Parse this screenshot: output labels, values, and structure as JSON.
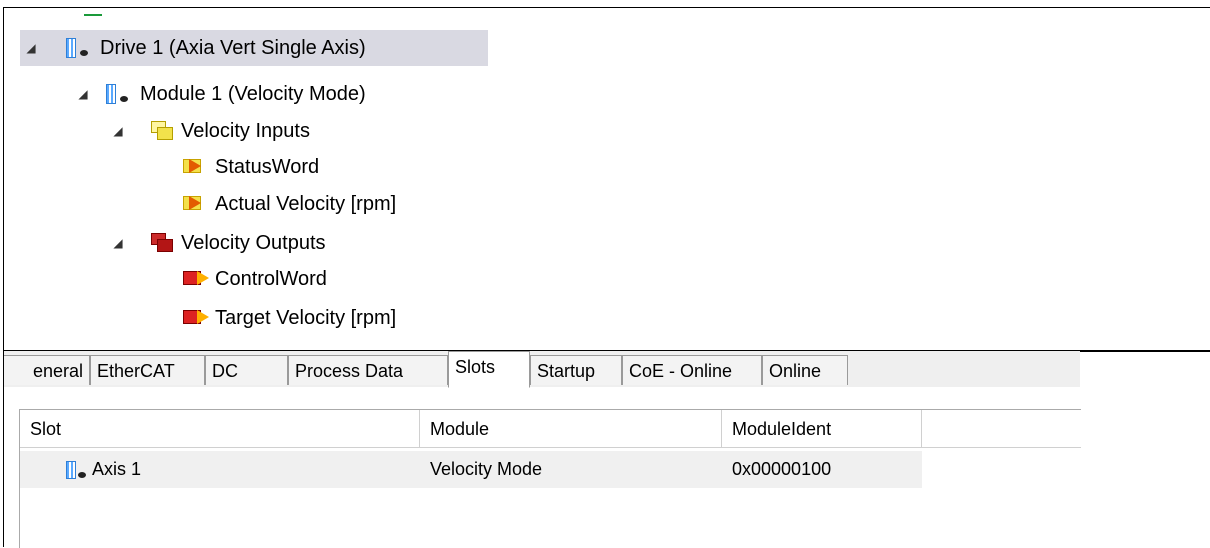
{
  "tree": {
    "items": [
      {
        "label": "Drive 1 (Axia Vert Single Axis)",
        "icon": "device-icon",
        "expanded": true
      },
      {
        "label": "Module 1 (Velocity Mode)",
        "icon": "device-icon",
        "expanded": true
      },
      {
        "label": "Velocity Inputs",
        "icon": "input-folder-icon",
        "expanded": true
      },
      {
        "label": "StatusWord",
        "icon": "input-variable-icon"
      },
      {
        "label": "Actual Velocity [rpm]",
        "icon": "input-variable-icon"
      },
      {
        "label": "Velocity Outputs",
        "icon": "output-folder-icon",
        "expanded": true
      },
      {
        "label": "ControlWord",
        "icon": "output-variable-icon"
      },
      {
        "label": "Target Velocity [rpm]",
        "icon": "output-variable-icon"
      }
    ]
  },
  "tabs": [
    "eneral",
    "EtherCAT",
    "DC",
    "Process Data",
    "Slots",
    "Startup",
    "CoE - Online",
    "Online"
  ],
  "active_tab": "Slots",
  "slots_table": {
    "columns": [
      "Slot",
      "Module",
      "ModuleIdent"
    ],
    "rows": [
      {
        "slot": "Axis 1",
        "module": "Velocity Mode",
        "ident": "0x00000100"
      }
    ]
  },
  "colors": {
    "selection": "#d9d9e2",
    "input_icon": "#f4e04a",
    "output_icon": "#cc2b2b"
  }
}
